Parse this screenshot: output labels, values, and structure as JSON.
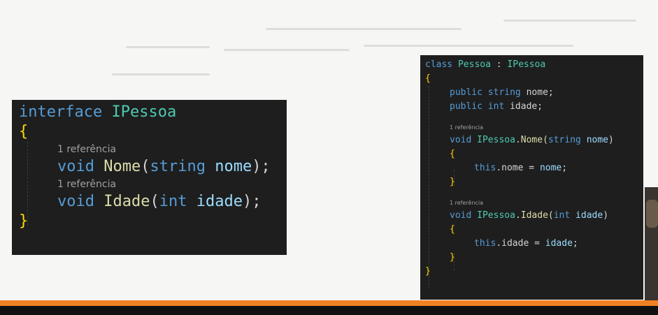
{
  "left_code": {
    "line1": {
      "kw": "interface",
      "name": "IPessoa"
    },
    "open_brace": "{",
    "hint1": "1 referência",
    "line_nome": {
      "kw": "void",
      "fn": "Nome",
      "open": "(",
      "ptype": "string",
      "param": "nome",
      "close": ");"
    },
    "hint2": "1 referência",
    "line_idade": {
      "kw": "void",
      "fn": "Idade",
      "open": "(",
      "ptype": "int",
      "param": "idade",
      "close": ");"
    },
    "close_brace": "}"
  },
  "right_code": {
    "line1": {
      "kw": "class",
      "name": "Pessoa",
      "sep": " : ",
      "iface": "IPessoa"
    },
    "open_brace": "{",
    "field1": {
      "mod": "public",
      "type": "string",
      "name": "nome;"
    },
    "field2": {
      "mod": "public",
      "type": "int",
      "name": "idade;"
    },
    "hint1": "1 referência",
    "method1": {
      "kw": "void",
      "iface": "IPessoa",
      "fn": ".Nome(",
      "ptype": "string",
      "param": "nome",
      "close": ")"
    },
    "m1_open": "{",
    "m1_body": {
      "this": "this",
      "lhs": ".nome = ",
      "rhs": "nome",
      "end": ";"
    },
    "m1_close": "}",
    "hint2": "1 referência",
    "method2": {
      "kw": "void",
      "iface": "IPessoa",
      "fn": ".Idade(",
      "ptype": "int",
      "param": "idade",
      "close": ")"
    },
    "m2_open": "{",
    "m2_body": {
      "this": "this",
      "lhs": ".idade = ",
      "rhs": "idade",
      "end": ";"
    },
    "m2_close": "}",
    "close_brace": "}"
  },
  "colors": {
    "keyword": "#569cd6",
    "type": "#4ec9b0",
    "function": "#dcdcaa",
    "parameter": "#9cdcfe",
    "accent_bar": "#f08123"
  }
}
